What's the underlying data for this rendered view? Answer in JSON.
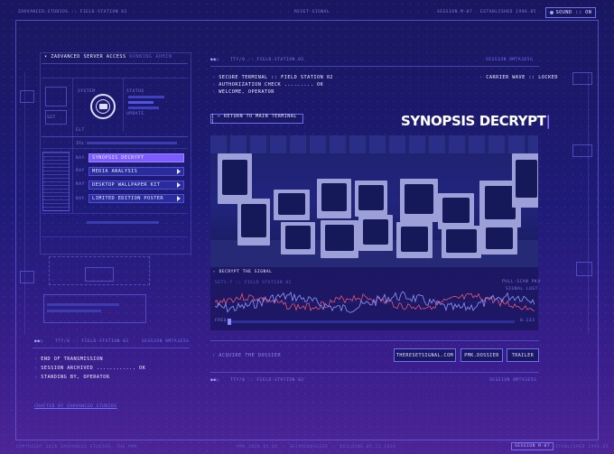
{
  "topbar": {
    "left": "ZADVANCED.STUDIOS :: FIELD-STATION 02",
    "center": "RESET-SIGNAL",
    "right1": "SESSION M-07",
    "right2": "ESTABLISHED 1996.05",
    "sound_label": "SOUND :: ON"
  },
  "left_panel": {
    "header": "ZADVANCED SERVER ACCESS",
    "header_sub": "RUNNING ADMIN",
    "small_labels": [
      "SYSTEM",
      "STATUS",
      "SET",
      "UPDATE",
      "ELT",
      "IRL",
      "RAY",
      "RAY",
      "RAY",
      "RAY"
    ],
    "menu": [
      {
        "label": "SYNOPSIS DECRYPT",
        "active": true
      },
      {
        "label": "MEDIA ANALYSIS",
        "active": false
      },
      {
        "label": "DESKTOP WALLPAPER KIT",
        "active": false
      },
      {
        "label": "LIMITED EDITION POSTER",
        "active": false
      }
    ]
  },
  "main": {
    "header_left": "TTY/0 :: FIELD-STATION 02",
    "header_right": "SESSION 8MTA3E5G",
    "terminal_lines": [
      "SECURE TERMINAL :: FIELD STATION 02",
      "AUTHORIZATION CHECK ......... OK",
      "WELCOME, OPERATOR"
    ],
    "carrier": "CARRIER WAVE :: LOCKED",
    "return_button": "[ ← RETURN TO MAIN TERMINAL ]",
    "title": "SYNOPSIS DECRYPT",
    "signal_header": "DECRYPT THE SIGNAL",
    "signal_sub": "SET1-7 :: FIELD STATION 02",
    "signal_right1": "PULL-SCAN PK4",
    "signal_right2": "SIGNAL LOST",
    "free_label": "FREQ",
    "free_right": "0.133",
    "acquire": "ACQUIRE THE DOSSIER",
    "buttons": [
      "THERESETSIGNAL.COM",
      "PMK.DOSSIER",
      "TRAILER"
    ],
    "footer_left": "TTY/0 :: FIELD-STATION 02",
    "footer_right": "SESSION 8MTA3E5G"
  },
  "bottom_left": {
    "header_left": "TTY/0 :: FIELD-STATION 02",
    "header_right": "SESSION 8MTA3E5G",
    "lines": [
      "END OF TRANSMISSION",
      "SESSION ARCHIVED ............ OK",
      "STANDING BY, OPERATOR"
    ],
    "credit": "CRAFTED BY ZADVANCED STUDIOS"
  },
  "footer": {
    "left": "COPYRIGHT 2026 ZADVANCED STUDIOS, THE PMK",
    "center": "PMK.2026.05.05 :: SECUREDOSSIER :: BUILDING 05.11.1026",
    "right1": "SESSION M-07",
    "right2": "ESTABLISHED 1996.05"
  },
  "colors": {
    "accent": "#7a5cff",
    "bg": "#1e1b78",
    "wave_red": "#ff5f78",
    "wave_blue": "#8a9bff"
  }
}
